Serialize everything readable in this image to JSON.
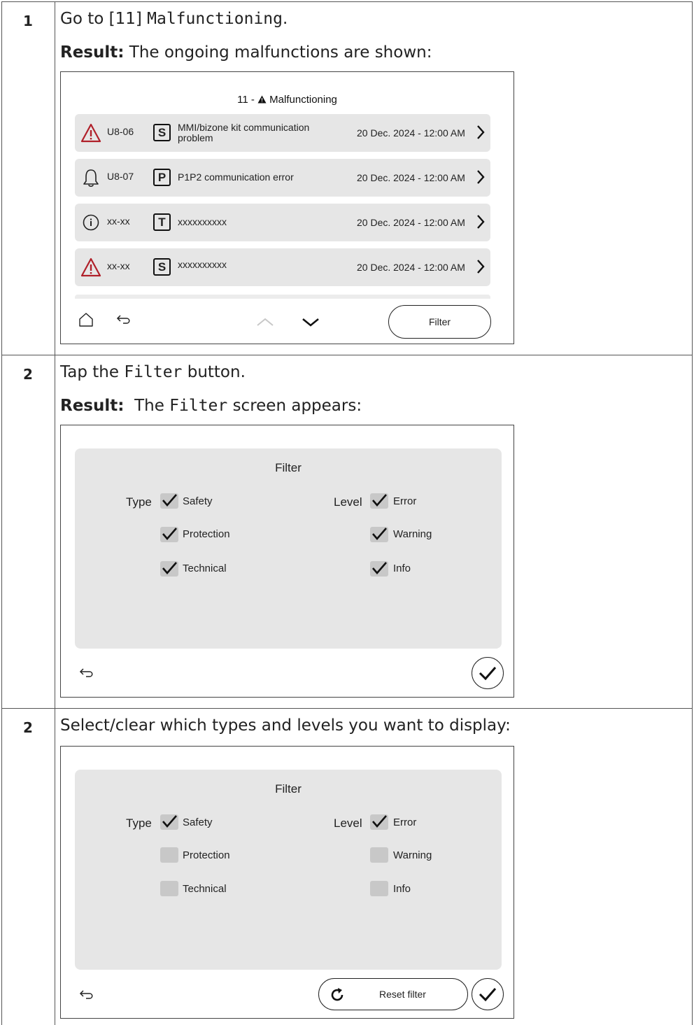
{
  "steps": [
    {
      "num": "1",
      "line1": {
        "pre": "Go to [11] ",
        "code": "Malfunctioning",
        "post": "."
      },
      "line2": {
        "bold": "Result:",
        "text": " The ongoing malfunctions are shown:"
      }
    },
    {
      "num": "2",
      "line1": {
        "pre": "Tap the ",
        "code": "Filter",
        "post": " button."
      },
      "line2": {
        "bold": "Result:",
        "pre": "  The ",
        "code": "Filter",
        "post": " screen appears:"
      }
    },
    {
      "num": "2",
      "line1": {
        "text": "Select/clear which types and levels you want to display:"
      }
    }
  ],
  "screen1": {
    "title_num": "11 - ",
    "title_text": "Malfunctioning",
    "rows": [
      {
        "icon": "warning-triangle-icon",
        "code": "U8-06",
        "badge": "S",
        "desc": "MMI/bizone kit communication problem",
        "date": "20 Dec. 2024 - 12:00 AM"
      },
      {
        "icon": "bell-icon",
        "code": "U8-07",
        "badge": "P",
        "desc": "P1P2 communication error",
        "date": "20 Dec. 2024 - 12:00 AM"
      },
      {
        "icon": "info-icon",
        "code": "xx-xx",
        "badge": "T",
        "desc": "xxxxxxxxxx",
        "date": "20 Dec. 2024 - 12:00 AM"
      },
      {
        "icon": "warning-triangle-icon",
        "code": "xx-xx",
        "badge": "S",
        "desc": "xxxxxxxxxx",
        "date": "20 Dec. 2024 - 12:00 AM"
      }
    ],
    "filter_button": "Filter"
  },
  "filter_screen_a": {
    "title": "Filter",
    "type_label": "Type",
    "level_label": "Level",
    "types": [
      {
        "label": "Safety",
        "checked": true
      },
      {
        "label": "Protection",
        "checked": true
      },
      {
        "label": "Technical",
        "checked": true
      }
    ],
    "levels": [
      {
        "label": "Error",
        "checked": true
      },
      {
        "label": "Warning",
        "checked": true
      },
      {
        "label": "Info",
        "checked": true
      }
    ]
  },
  "filter_screen_b": {
    "title": "Filter",
    "type_label": "Type",
    "level_label": "Level",
    "types": [
      {
        "label": "Safety",
        "checked": true
      },
      {
        "label": "Protection",
        "checked": false
      },
      {
        "label": "Technical",
        "checked": false
      }
    ],
    "levels": [
      {
        "label": "Error",
        "checked": true
      },
      {
        "label": "Warning",
        "checked": false
      },
      {
        "label": "Info",
        "checked": false
      }
    ],
    "reset_button": "Reset filter"
  },
  "colors": {
    "alert_red": "#b0202a",
    "panel_gray": "#e6e6e6",
    "checkbox_gray": "#c8c8c8"
  }
}
